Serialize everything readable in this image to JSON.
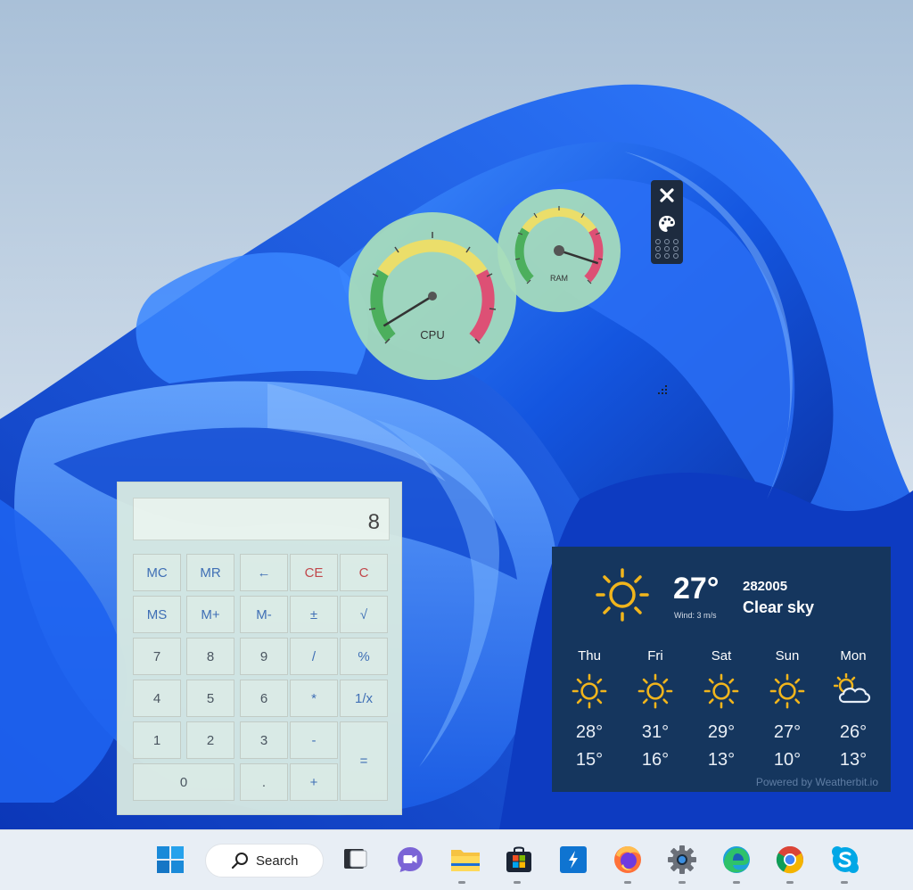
{
  "gauges": {
    "cpu": {
      "label": "CPU",
      "level": 0.05
    },
    "ram": {
      "label": "RAM",
      "level": 0.9
    }
  },
  "gadget_toolbar": {
    "icons": [
      "close-icon",
      "palette-icon",
      "drag-grip-icon"
    ]
  },
  "calculator": {
    "display": "8",
    "keys": [
      [
        "MC",
        "MR",
        "←",
        "CE",
        "C"
      ],
      [
        "MS",
        "M+",
        "M-",
        "±",
        "√"
      ],
      [
        "7",
        "8",
        "9",
        "/",
        "%"
      ],
      [
        "4",
        "5",
        "6",
        "*",
        "1/x"
      ],
      [
        "1",
        "2",
        "3",
        "-",
        "="
      ],
      [
        "0",
        ".",
        "+"
      ]
    ]
  },
  "weather": {
    "current": {
      "temp": "27°",
      "wind": "Wind: 3 m/s",
      "location": "282005",
      "condition": "Clear sky",
      "icon": "sun-icon"
    },
    "forecast": [
      {
        "day": "Thu",
        "high": "28°",
        "low": "15°",
        "icon": "sun-icon"
      },
      {
        "day": "Fri",
        "high": "31°",
        "low": "16°",
        "icon": "sun-icon"
      },
      {
        "day": "Sat",
        "high": "29°",
        "low": "13°",
        "icon": "sun-icon"
      },
      {
        "day": "Sun",
        "high": "27°",
        "low": "10°",
        "icon": "sun-icon"
      },
      {
        "day": "Mon",
        "high": "26°",
        "low": "13°",
        "icon": "partly-cloudy-icon"
      }
    ],
    "powered_by": "Powered by Weatherbit.io",
    "colors": {
      "sun": "#f1b51c",
      "panel": "#15365e"
    }
  },
  "taskbar": {
    "search_label": "Search",
    "apps": [
      "windows-start",
      "search",
      "task-view",
      "teams-chat",
      "file-explorer",
      "microsoft-store",
      "visual-studio",
      "firefox",
      "settings",
      "edge",
      "chrome",
      "skype"
    ]
  }
}
